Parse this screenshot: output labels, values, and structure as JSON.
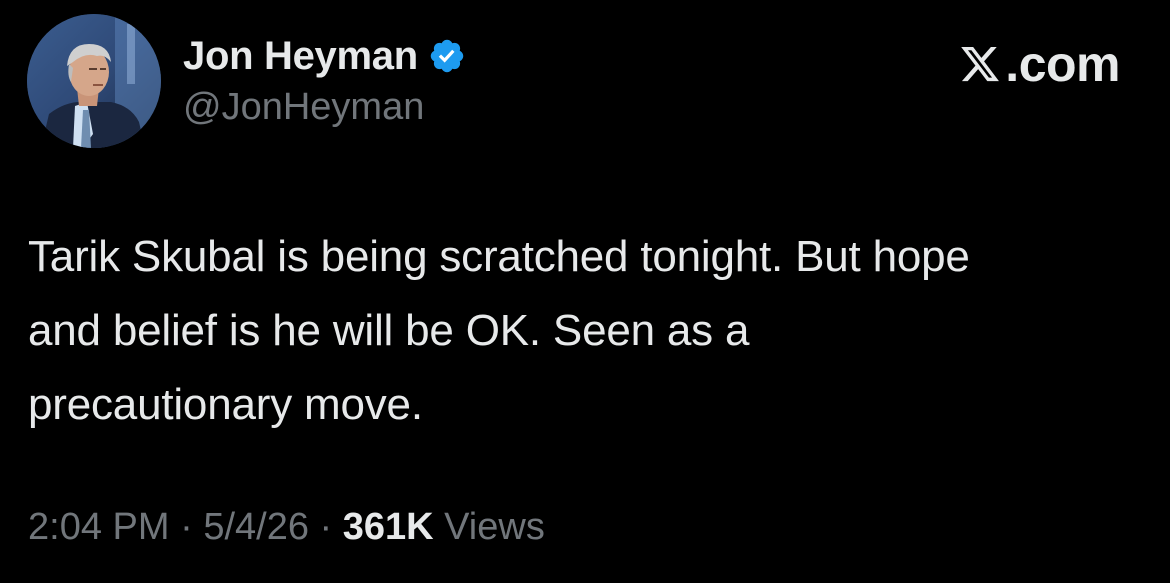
{
  "author": {
    "display_name": "Jon Heyman",
    "handle": "@JonHeyman",
    "verified": true,
    "verified_color": "#1d9bf0"
  },
  "brand": {
    "logo_icon": "x-logo-icon",
    "text": ".com"
  },
  "tweet": {
    "lines": [
      "Tarik Skubal is being scratched tonight. But hope",
      "and belief is he will be OK. Seen as a",
      "precautionary move."
    ]
  },
  "meta": {
    "time": "2:04 PM",
    "separator1": " · ",
    "date": "5/4/26",
    "separator2": " · ",
    "views_count": "361K",
    "views_label": " Views"
  },
  "colors": {
    "background": "#000000",
    "primary_text": "#e7e9ea",
    "secondary_text": "#71767b"
  }
}
